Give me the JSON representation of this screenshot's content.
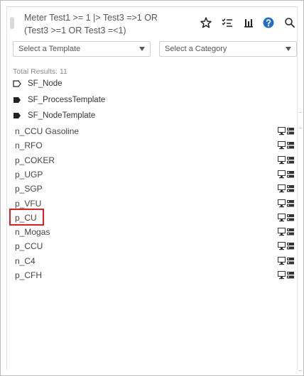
{
  "header": {
    "query_line1": "Meter Test1 >= 1 |> Test3 =>1 OR",
    "query_line2": "(Test3 >=1 OR Test3 =<1)",
    "icons": [
      "star-icon",
      "checklist-sort-icon",
      "bar-chart-icon",
      "help-icon",
      "search-icon"
    ],
    "help_color": "#1f6fc4"
  },
  "filters": {
    "template_placeholder": "Select a Template",
    "category_placeholder": "Select a Category"
  },
  "results": {
    "total_label": "Total Results: 11",
    "tags": [
      {
        "label": "SF_Node",
        "style": "outline"
      },
      {
        "label": "SF_ProcessTemplate",
        "style": "filled"
      },
      {
        "label": "SF_NodeTemplate",
        "style": "filled"
      }
    ],
    "items": [
      {
        "label": "n_CCU Gasoline"
      },
      {
        "label": "n_RFO"
      },
      {
        "label": "p_COKER"
      },
      {
        "label": "p_UGP"
      },
      {
        "label": "p_SGP"
      },
      {
        "label": "p_VFU"
      },
      {
        "label": "p_CU",
        "highlighted": true
      },
      {
        "label": "n_Mogas"
      },
      {
        "label": "p_CCU"
      },
      {
        "label": "n_C4"
      },
      {
        "label": "p_CFH"
      }
    ],
    "highlight_color": "#e02020"
  }
}
